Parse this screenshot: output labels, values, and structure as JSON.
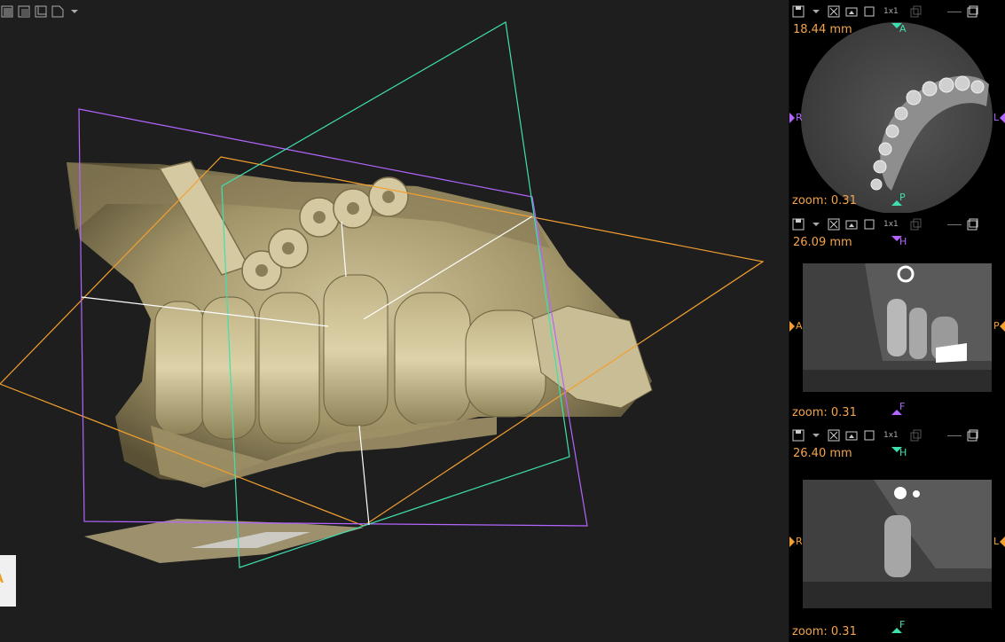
{
  "panes": [
    {
      "id": "axial",
      "layout": "1x1",
      "distance": "18.44 mm",
      "zoom": "zoom: 0.31",
      "top": "A",
      "bottom": "P",
      "left": "R",
      "right": "L",
      "colors": {
        "vertical": "#3fe0b0",
        "horizontal": "#b366ff"
      }
    },
    {
      "id": "sagittal",
      "layout": "1x1",
      "distance": "26.09 mm",
      "zoom": "zoom: 0.31",
      "top": "H",
      "bottom": "F",
      "left": "A",
      "right": "P",
      "colors": {
        "vertical": "#b366ff",
        "horizontal": "#f4a030"
      }
    },
    {
      "id": "coronal",
      "layout": "1x1",
      "distance": "26.40 mm",
      "zoom": "zoom: 0.31",
      "top": "H",
      "bottom": "F",
      "left": "R",
      "right": "L",
      "colors": {
        "vertical": "#3fe0b0",
        "horizontal": "#f4a030"
      }
    }
  ],
  "orientation_cube": {
    "label": "A"
  },
  "colors": {
    "label_text": "#f4a44a",
    "plane_axial": "#f4a030",
    "plane_sagittal": "#b366ff",
    "plane_coronal": "#3fe0b0",
    "bone": "#c8b98a"
  }
}
